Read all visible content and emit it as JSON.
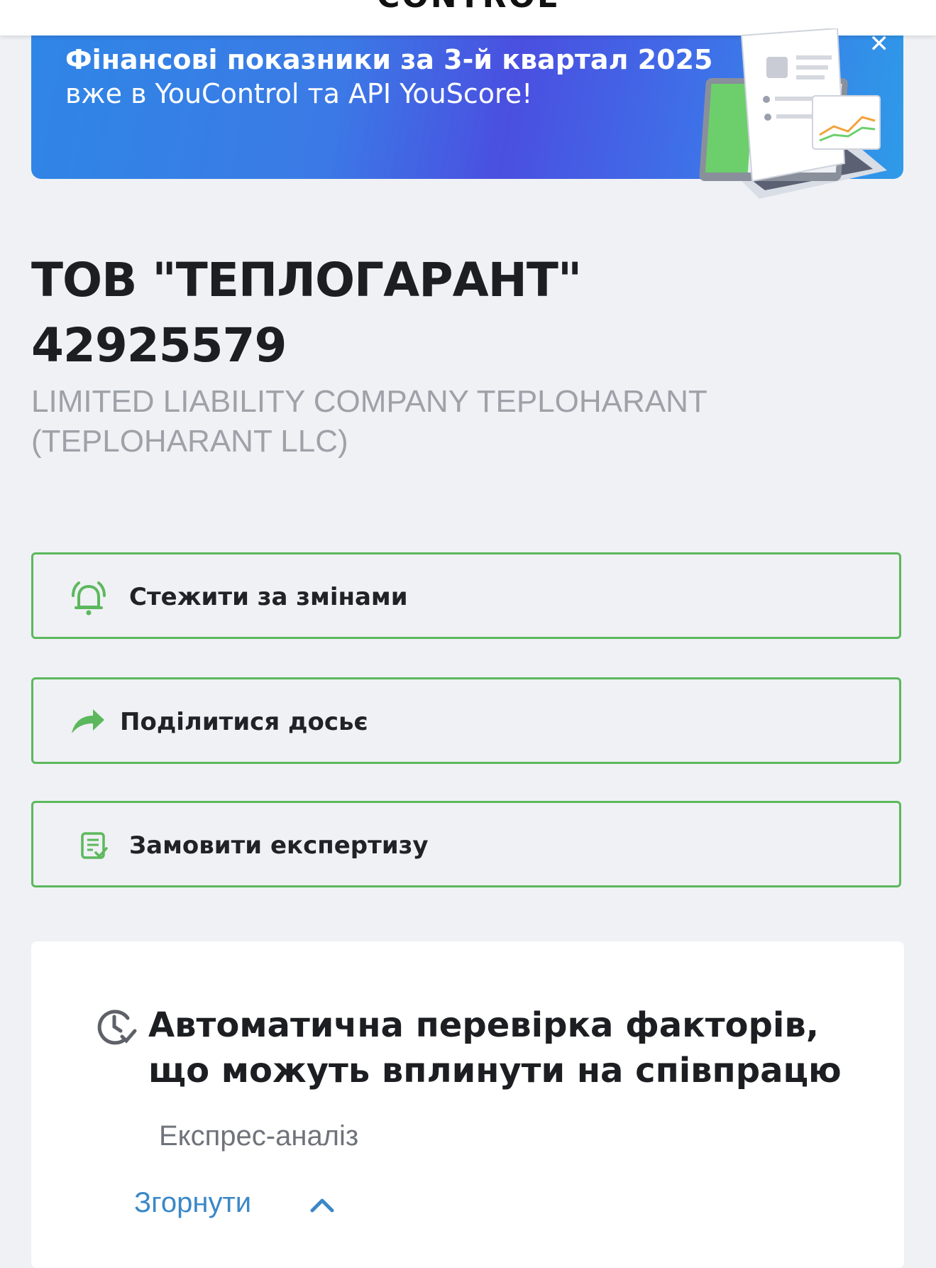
{
  "header": {
    "logo_text": "CONTROL"
  },
  "banner": {
    "line1": "Фінансові показники за 3-й квартал 2025",
    "line2": "вже в YouControl та API YouScore!",
    "close_icon": "close-icon"
  },
  "company": {
    "name": "ТОВ \"ТЕПЛОГАРАНТ\"",
    "code": "42925579",
    "english_name": "LIMITED LIABILITY COMPANY TEPLOHARANT (TEPLOHARANT LLC)"
  },
  "actions": [
    {
      "label": "Стежити за змінами",
      "icon": "bell-icon"
    },
    {
      "label": "Поділитися досьє",
      "icon": "share-arrow-icon"
    },
    {
      "label": "Замовити експертизу",
      "icon": "document-check-icon"
    }
  ],
  "check_card": {
    "title": "Автоматична перевірка факторів, що можуть вплинути на співпрацю",
    "subtitle": "Експрес-аналіз",
    "collapse_label": "Згорнути",
    "icon": "clock-check-icon"
  },
  "colors": {
    "accent_green": "#5cb85c",
    "link_blue": "#3a88c8",
    "banner_blue": "#4a4fe0"
  }
}
